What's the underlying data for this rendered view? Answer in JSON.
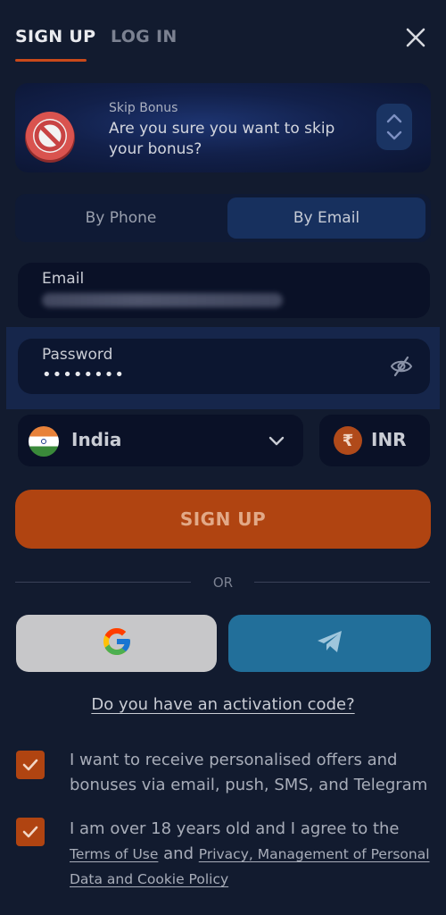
{
  "tabs": {
    "signup": "SIGN UP",
    "login": "LOG IN"
  },
  "icons": {
    "close": "close-icon",
    "bonus_badge": "no-entry-icon",
    "switch": "chevron-up-down-icon",
    "password_visibility": "eye-off-icon",
    "country_dropdown": "chevron-down-icon",
    "google": "google-logo-icon",
    "telegram": "telegram-logo-icon",
    "checkbox": "checkmark-icon"
  },
  "bonus": {
    "label": "Skip Bonus",
    "text": "Are you sure you want to skip your bonus?"
  },
  "method_toggle": {
    "phone": "By Phone",
    "email": "By Email",
    "selected": "By Email"
  },
  "email_field": {
    "label": "Email"
  },
  "password_field": {
    "label": "Password",
    "value": "••••••••"
  },
  "country": {
    "name": "India"
  },
  "currency": {
    "symbol": "₹",
    "code": "INR"
  },
  "signup_button": "SIGN UP",
  "or_divider": "OR",
  "activation_link": "Do you have an activation code?",
  "consents": {
    "offers": "I want to receive personalised offers and bonuses via email, push, SMS, and Telegram",
    "age_prefix": "I am over 18 years old and I agree to the",
    "terms_link": "Terms of Use",
    "and_word": "and",
    "privacy_link": "Privacy, Management of Personal Data and Cookie Policy"
  },
  "colors": {
    "background": "#121b2f",
    "accent": "#b04411",
    "google_button": "#c7c7c9",
    "telegram_button": "#226f9a"
  }
}
